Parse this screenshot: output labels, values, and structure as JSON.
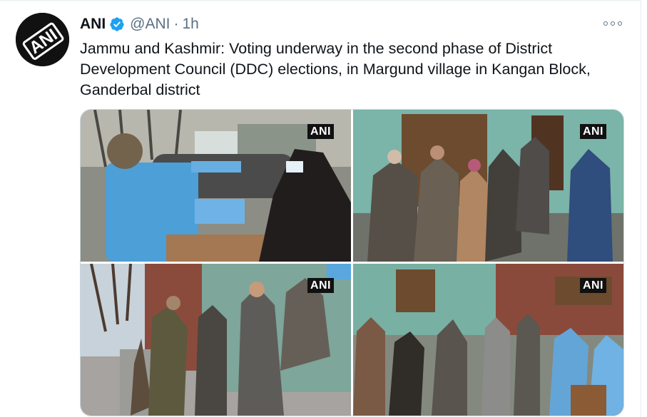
{
  "account": {
    "display_name": "ANI",
    "handle": "@ANI",
    "separator": "·",
    "timestamp": "1h",
    "avatar_icon": "ani-logo-icon",
    "verified_icon": "verified-badge-icon"
  },
  "tweet": {
    "text": "Jammu and Kashmir: Voting underway in the second phase of District\nDevelopment Council (DDC) elections, in Margund village in Kangan Block,\nGanderbal district"
  },
  "media": {
    "watermark": "ANI",
    "photos": [
      {
        "watermark": "ANI"
      },
      {
        "watermark": "ANI"
      },
      {
        "watermark": "ANI"
      },
      {
        "watermark": "ANI"
      }
    ]
  },
  "actions": {
    "more_icon": "more-options-icon"
  },
  "colors": {
    "text": "#0f1419",
    "secondary": "#5b7083",
    "verified": "#1da1f2",
    "border": "#ccd6dd"
  }
}
